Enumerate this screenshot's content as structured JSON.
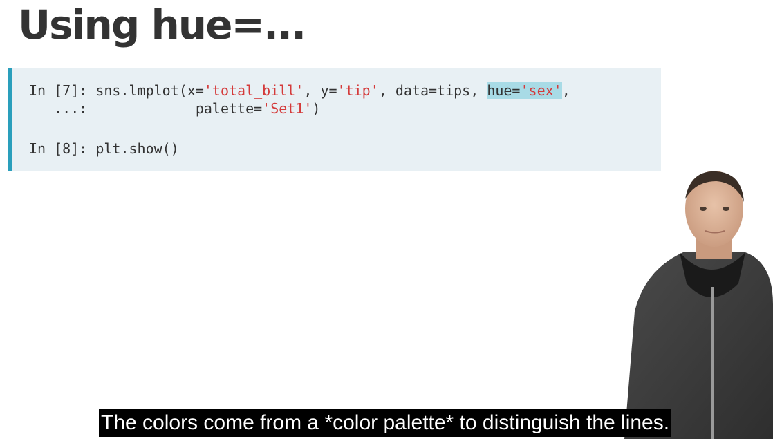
{
  "slide": {
    "title": "Using hue=..."
  },
  "code": {
    "line1": {
      "prompt": "In [7]: ",
      "call": "sns.lmplot(x=",
      "x_str": "'total_bill'",
      "sep1": ", y=",
      "y_str": "'tip'",
      "sep2": ", data=tips, ",
      "hue_key": "hue=",
      "hue_str": "'sex'",
      "end": ","
    },
    "line2": {
      "prompt": "   ...:             ",
      "key": "palette=",
      "val": "'Set1'",
      "end": ")"
    },
    "line3": {
      "prompt": "In [8]: ",
      "call": "plt.show()"
    }
  },
  "caption": "The colors come from a *color palette* to distinguish the lines.",
  "colors": {
    "accent_bar": "#2a9fbc",
    "string": "#d43a3a",
    "highlight": "#a8dbe6"
  }
}
